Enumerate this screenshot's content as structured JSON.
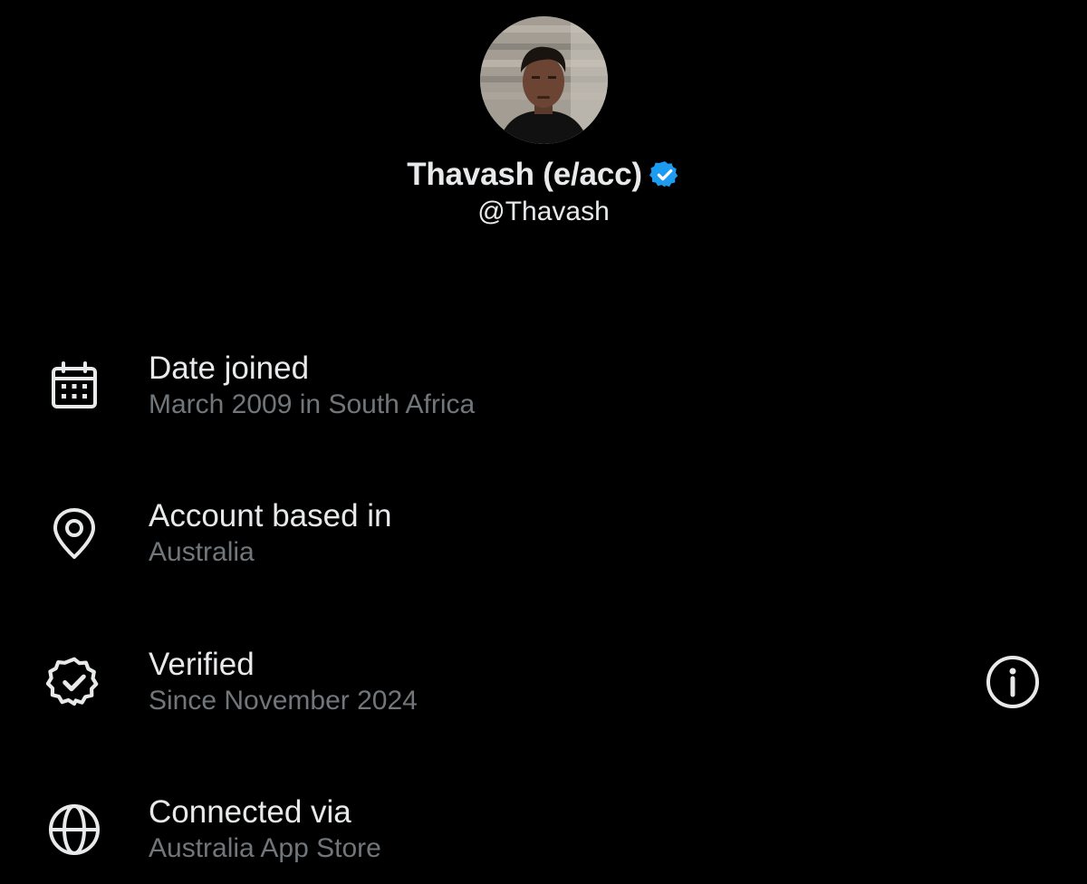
{
  "profile": {
    "display_name": "Thavash (e/acc)",
    "handle": "@Thavash",
    "verified": true
  },
  "colors": {
    "background": "#000000",
    "primary_text": "#e7e9ea",
    "secondary_text": "#71767b",
    "verified_blue": "#1d9bf0",
    "icon": "#e7e9ea"
  },
  "details": [
    {
      "icon": "calendar-icon",
      "title": "Date joined",
      "value": "March 2009 in South Africa"
    },
    {
      "icon": "location-pin-icon",
      "title": "Account based in",
      "value": "Australia"
    },
    {
      "icon": "verified-badge-outline-icon",
      "title": "Verified",
      "value": "Since November 2024",
      "action_icon": "info-icon"
    },
    {
      "icon": "globe-icon",
      "title": "Connected via",
      "value": "Australia App Store"
    }
  ]
}
